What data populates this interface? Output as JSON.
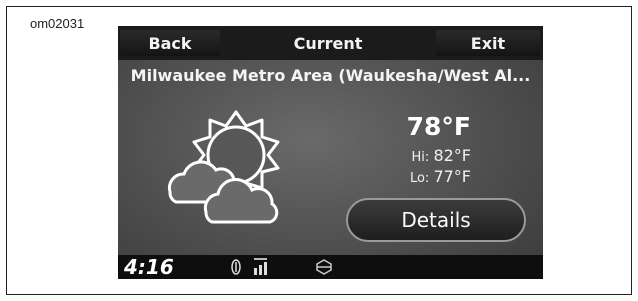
{
  "figure_id": "om02031",
  "header": {
    "back_label": "Back",
    "title": "Current",
    "exit_label": "Exit"
  },
  "location": "Milwaukee Metro Area (Waukesha/West Al...",
  "weather": {
    "condition_icon": "partly-cloudy-icon",
    "temperature": "78°F",
    "hi_label": "Hi:",
    "hi_value": "82°F",
    "lo_label": "Lo:",
    "lo_value": "77°F"
  },
  "details_label": "Details",
  "status": {
    "time": "4:16",
    "icons": [
      "gps-icon",
      "signal-strength-icon",
      "harley-logo-icon"
    ]
  },
  "colors": {
    "screen_bg": "#4f4f4f",
    "bar_bg": "#1b1b1b",
    "text": "#f4f4f4"
  }
}
